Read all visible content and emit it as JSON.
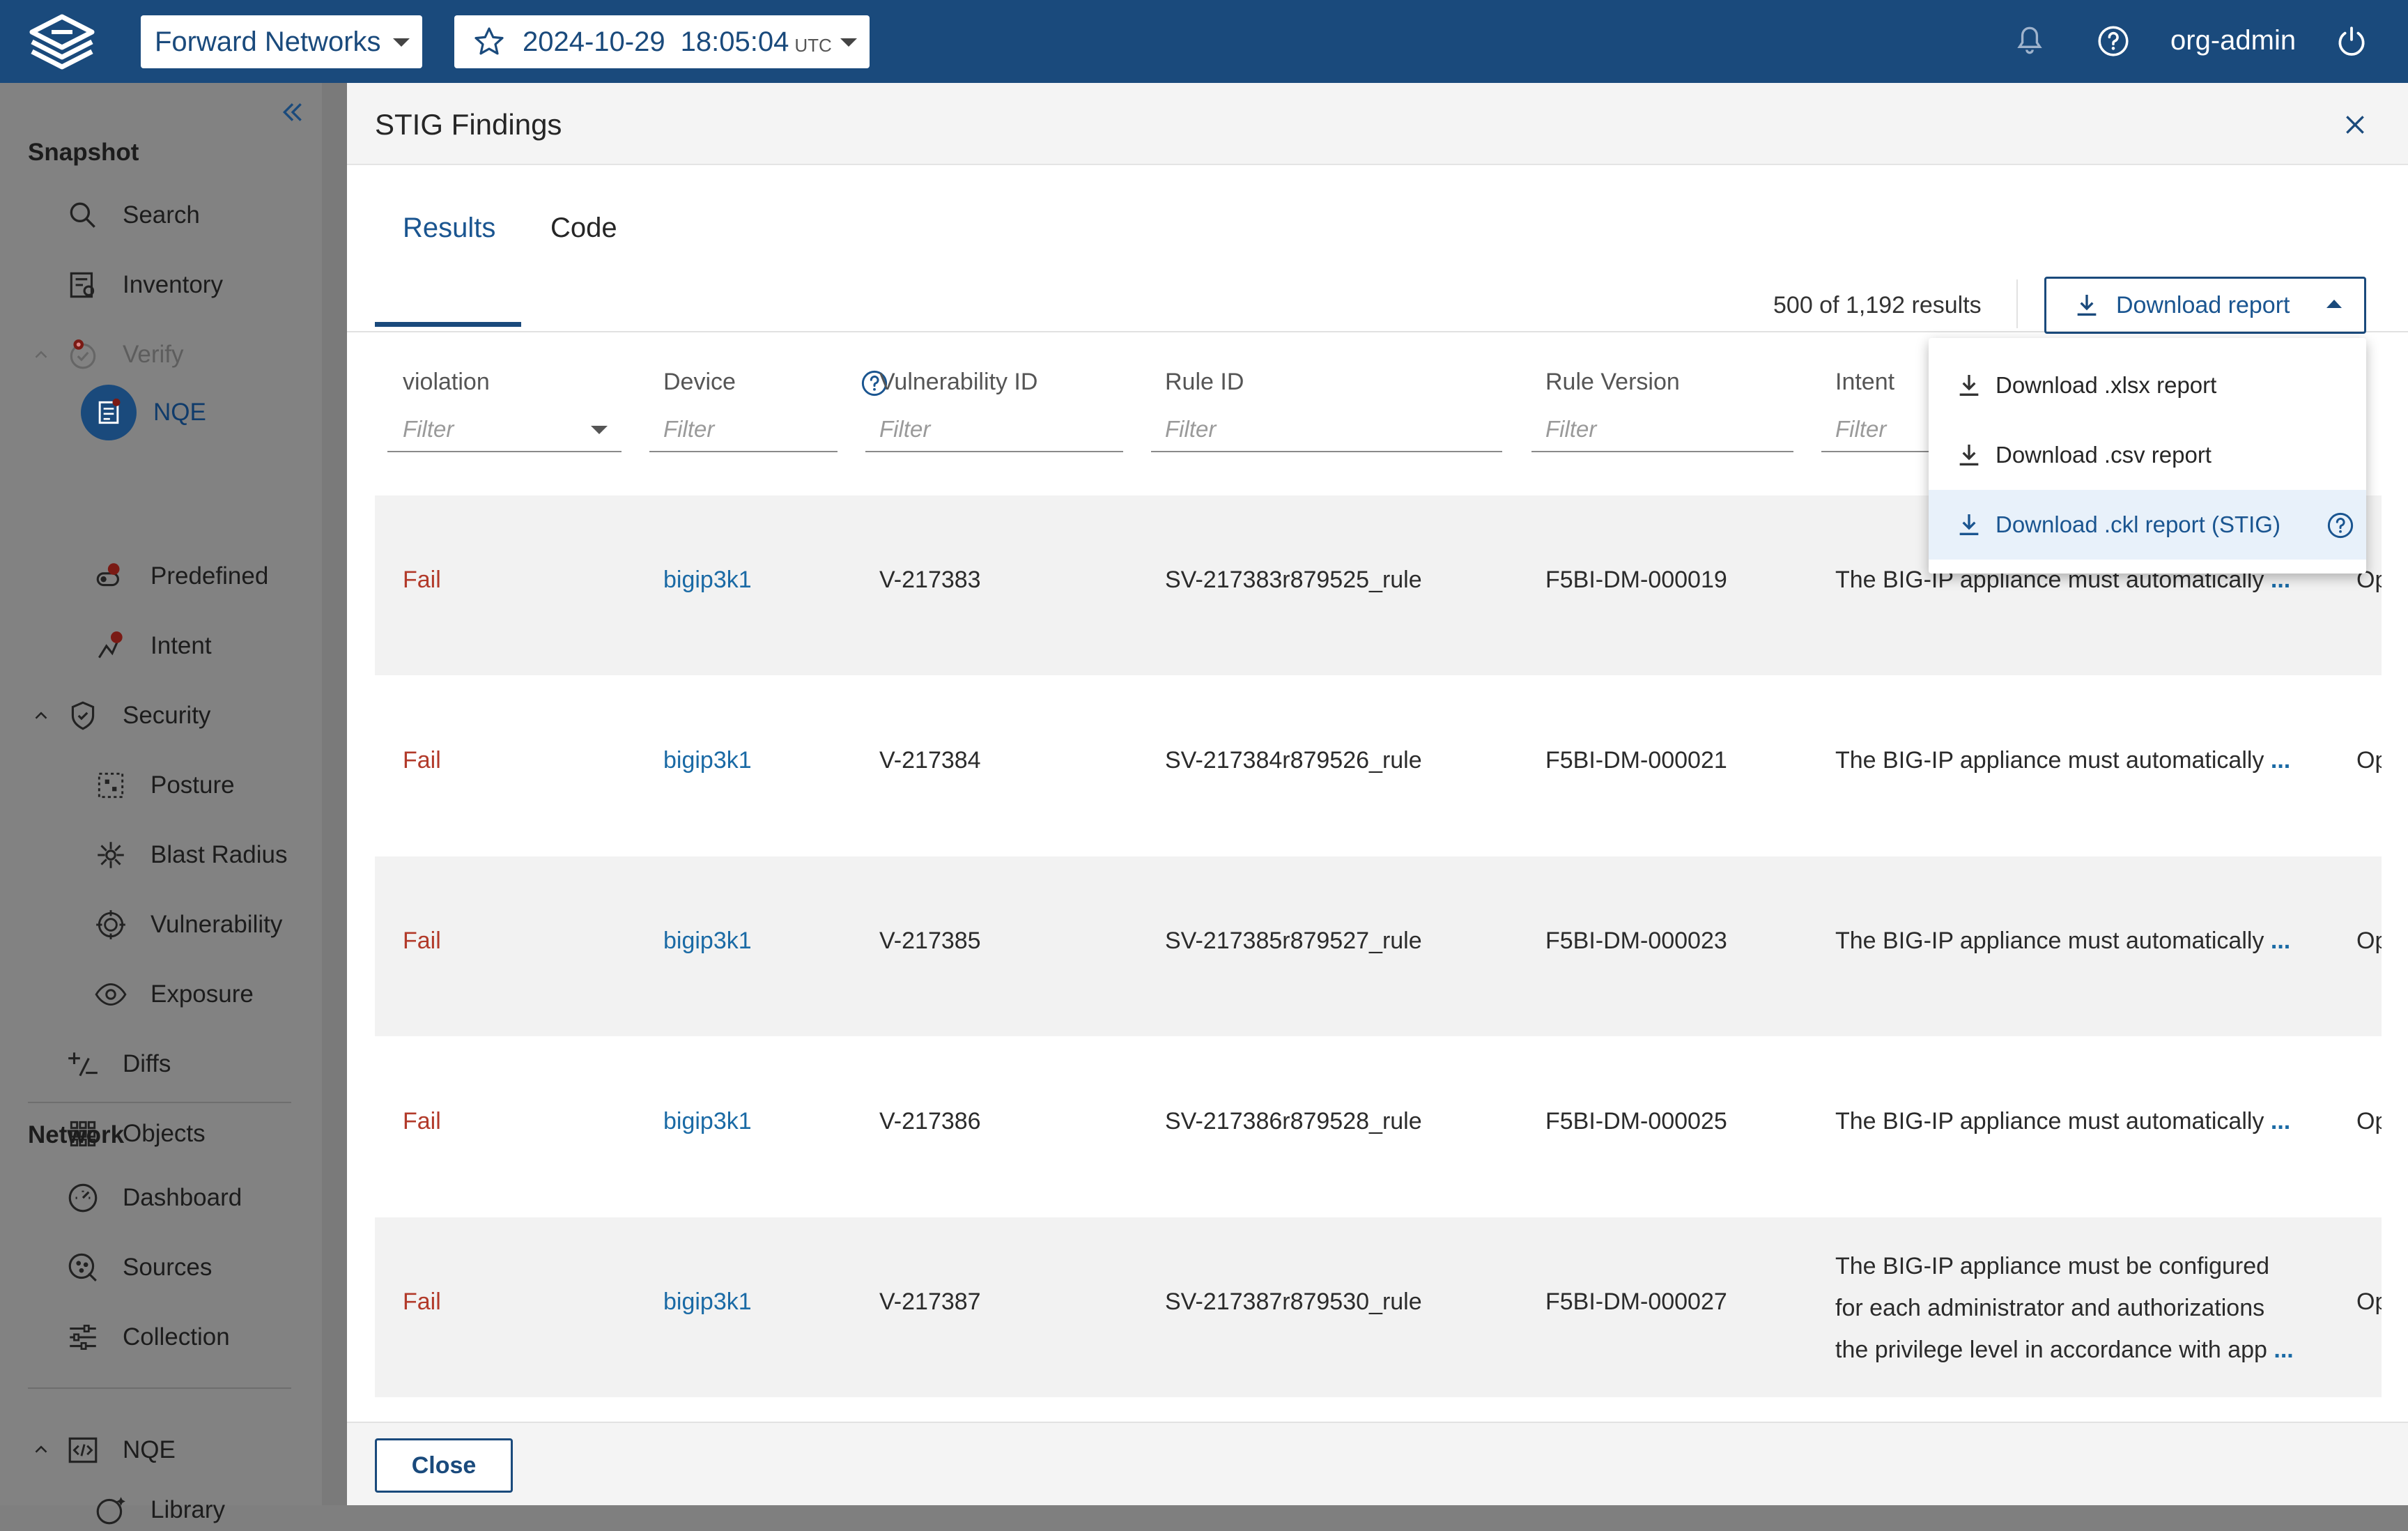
{
  "topbar": {
    "org": "Forward Networks",
    "date": "2024-10-29",
    "time": "18:05:04",
    "tz": "UTC",
    "user": "org-admin"
  },
  "sidebar": {
    "snapshot_title": "Snapshot",
    "items": {
      "search": "Search",
      "inventory": "Inventory",
      "verify": "Verify",
      "nqe": "NQE",
      "predefined": "Predefined",
      "intent": "Intent",
      "security": "Security",
      "posture": "Posture",
      "blast_radius": "Blast Radius",
      "vulnerability": "Vulnerability",
      "exposure": "Exposure",
      "diffs": "Diffs",
      "objects": "Objects"
    },
    "network_title": "Network",
    "network_items": {
      "dashboard": "Dashboard",
      "sources": "Sources",
      "collection": "Collection"
    },
    "nqe_section": "NQE",
    "library": "Library"
  },
  "modal": {
    "title": "STIG Findings",
    "tabs": [
      "Results",
      "Code"
    ],
    "result_count": "500 of 1,192 results",
    "download_label": "Download report",
    "columns": [
      "violation",
      "Device",
      "Vulnerability ID",
      "Rule ID",
      "Rule Version",
      "Intent"
    ],
    "filter_placeholder": "Filter",
    "rows": [
      {
        "violation": "Fail",
        "device": "bigip3k1",
        "vuln_id": "V-217383",
        "rule_id": "SV-217383r879525_rule",
        "rule_version": "F5BI-DM-000019",
        "intent": [
          "The BIG-IP appliance must automatically"
        ],
        "extra": "Op"
      },
      {
        "violation": "Fail",
        "device": "bigip3k1",
        "vuln_id": "V-217384",
        "rule_id": "SV-217384r879526_rule",
        "rule_version": "F5BI-DM-000021",
        "intent": [
          "The BIG-IP appliance must automatically"
        ],
        "extra": "Op"
      },
      {
        "violation": "Fail",
        "device": "bigip3k1",
        "vuln_id": "V-217385",
        "rule_id": "SV-217385r879527_rule",
        "rule_version": "F5BI-DM-000023",
        "intent": [
          "The BIG-IP appliance must automatically"
        ],
        "extra": "Op"
      },
      {
        "violation": "Fail",
        "device": "bigip3k1",
        "vuln_id": "V-217386",
        "rule_id": "SV-217386r879528_rule",
        "rule_version": "F5BI-DM-000025",
        "intent": [
          "The BIG-IP appliance must automatically"
        ],
        "extra": "Op"
      },
      {
        "violation": "Fail",
        "device": "bigip3k1",
        "vuln_id": "V-217387",
        "rule_id": "SV-217387r879530_rule",
        "rule_version": "F5BI-DM-000027",
        "intent": [
          "The BIG-IP appliance must be configured",
          "for each administrator and authorizations",
          "the privilege level in accordance with app"
        ],
        "extra": "Op"
      }
    ],
    "ellipsis": "...",
    "close_label": "Close"
  },
  "download_menu": {
    "items": [
      "Download .xlsx report",
      "Download .csv report",
      "Download .ckl report (STIG)"
    ]
  },
  "colors": {
    "brand": "#1a4a7c",
    "fail": "#b23a2a",
    "link": "#1a6aa5"
  }
}
